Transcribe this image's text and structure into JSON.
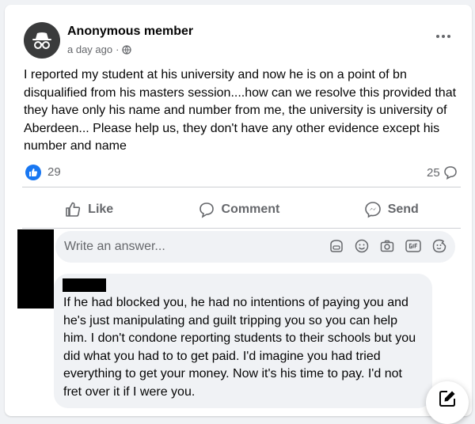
{
  "post": {
    "author": "Anonymous member",
    "timestamp": "a day ago",
    "audience_icon": "globe-icon",
    "text": "I reported my student at his university and now he is on a point of bn disqualified from his masters session....how can we resolve this provided that they have only his name and number from me, the university is university of Aberdeen... Please help us, they don't have any other evidence except his number and name"
  },
  "stats": {
    "like_count": "29",
    "comment_count": "25"
  },
  "actions": {
    "like": "Like",
    "comment": "Comment",
    "send": "Send"
  },
  "answer_box": {
    "placeholder": "Write an answer..."
  },
  "comment": {
    "text": "If he had blocked you, he had no intentions of paying you and he's just manipulating and guilt tripping you so you can help him. I don't condone reporting students to their schools but you did what you had to to get paid. I'd imagine you had tried everything to get your money. Now it's his time to pay. I'd not fret over it if I were you."
  },
  "colors": {
    "accent": "#1877f2",
    "secondary_text": "#65676b",
    "primary_text": "#050505",
    "bubble": "#f0f2f5"
  }
}
